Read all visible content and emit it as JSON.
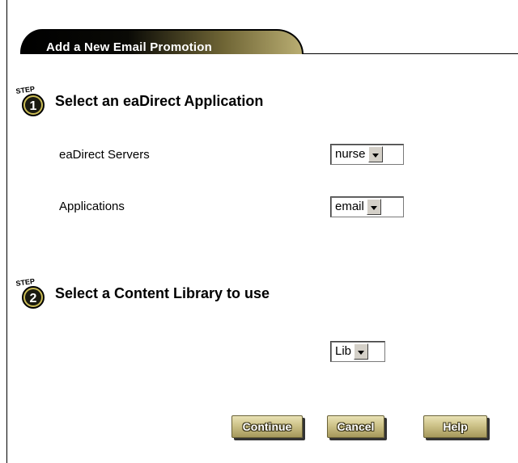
{
  "header": {
    "title": "Add a New Email Promotion"
  },
  "step1": {
    "badge_text": "STEP",
    "badge_number": "1",
    "title": "Select an eaDirect Application",
    "fields": [
      {
        "label": "eaDirect Servers",
        "value": "nurse"
      },
      {
        "label": "Applications",
        "value": "email"
      }
    ]
  },
  "step2": {
    "badge_text": "STEP",
    "badge_number": "2",
    "title": "Select a Content Library to use",
    "library_value": "Lib"
  },
  "buttons": {
    "continue": "Continue",
    "cancel": "Cancel",
    "help": "Help"
  },
  "colors": {
    "tab_dark": "#000000",
    "tab_light": "#b9ad72",
    "button_gold": "#cdc288",
    "badge_gold": "#c9bb55"
  }
}
